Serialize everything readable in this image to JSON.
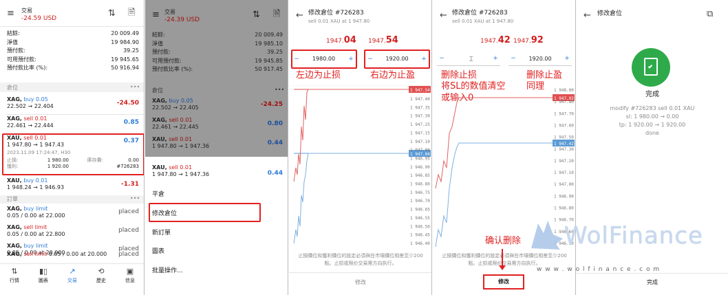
{
  "panel1": {
    "title": "交易",
    "balance_change": "-24.59 USD",
    "summary": [
      {
        "label": "結餘:",
        "value": "20 009.49"
      },
      {
        "label": "淨值",
        "value": "19 984.90"
      },
      {
        "label": "預付款:",
        "value": "39.25"
      },
      {
        "label": "可用預付款:",
        "value": "19 945.65"
      },
      {
        "label": "預付款比率 (%):",
        "value": "50 916.94"
      }
    ],
    "positions_header": "倉位",
    "more": "•••",
    "positions": [
      {
        "sym": "XAG,",
        "side": "buy 0.05",
        "prices": "22.502 → 22.404",
        "profit": "-24.50"
      },
      {
        "sym": "XAG,",
        "side": "sell 0.01",
        "prices": "22.461 → 22.444",
        "profit": "0.85"
      },
      {
        "sym": "XAU,",
        "side": "sell 0.01",
        "prices": "1 947.80 → 1 947.43",
        "profit": "0.37"
      },
      {
        "sym": "XAU,",
        "side": "buy 0.01",
        "prices": "1 948.24 → 1 946.93",
        "profit": "-1.31"
      }
    ],
    "detail_time": "2023.11.09 17:24:47, H30",
    "detail_sl_label": "止損:",
    "detail_sl": "1 980.00",
    "detail_swap_label": "庫存費:",
    "detail_swap": "0.00",
    "detail_tp_label": "獲利:",
    "detail_tp": "1 920.00",
    "detail_ticket": "#726283",
    "orders_header": "訂單",
    "orders": [
      {
        "sym": "XAG,",
        "side": "buy limit",
        "desc": "0.05 / 0.00 at 22.000",
        "status": "placed"
      },
      {
        "sym": "XAG,",
        "side": "sell limit",
        "desc": "0.05 / 0.00 at 22.800",
        "status": "placed"
      },
      {
        "sym": "XAG,",
        "side": "buy limit",
        "desc": "0.05 / 0.00 at 20.000",
        "status": "placed"
      },
      {
        "sym": "XAG,",
        "side": "sell limit",
        "desc": "0.05 / 0.00 at 20.000",
        "status": "placed"
      }
    ],
    "nav": [
      "行情",
      "圖表",
      "交易",
      "歷史",
      "信息"
    ]
  },
  "panel2": {
    "title": "交易",
    "balance_change": "-24.39 USD",
    "summary": [
      {
        "label": "結餘:",
        "value": "20 009.49"
      },
      {
        "label": "淨值",
        "value": "19 985.10"
      },
      {
        "label": "預付款:",
        "value": "39.25"
      },
      {
        "label": "可用預付款:",
        "value": "19 945.85"
      },
      {
        "label": "預付款比率 (%):",
        "value": "50 917.45"
      }
    ],
    "positions_header": "倉位",
    "more": "•••",
    "positions": [
      {
        "sym": "XAG,",
        "side": "buy 0.05",
        "prices": "22.502 → 22.405",
        "profit": "-24.25"
      },
      {
        "sym": "XAG,",
        "side": "sell 0.01",
        "prices": "22.461 → 22.445",
        "profit": "0.80"
      },
      {
        "sym": "XAU,",
        "side": "sell 0.01",
        "prices": "1 947.80 → 1 947.36",
        "profit": "0.44"
      },
      {
        "sym": "XAU,",
        "side": "sell 0.01",
        "prices": "1 947.80 → 1 947.36",
        "profit": "0.44"
      }
    ],
    "detail_time": "2023.11.09 17:24:47, H30",
    "menu": [
      "平倉",
      "修改倉位",
      "新訂單",
      "圖表",
      "批量操作..."
    ]
  },
  "panel3": {
    "title": "修改倉位 #726283",
    "subtitle": "sell 0.01 XAU at 1 947.80",
    "bid_main": "1947.",
    "bid_big": "04",
    "ask_main": "1947.",
    "ask_big": "54",
    "sl_value": "1980.00",
    "tp_value": "1920.00",
    "minus": "−",
    "plus": "+",
    "ann_left": "左边为止损",
    "ann_right": "右边为止盈",
    "price_labels": [
      "1 947.40",
      "1 947.35",
      "1 947.30",
      "1 947.25",
      "1 947.15",
      "1 947.10",
      "1 947.00",
      "1 946.95",
      "1 946.90",
      "1 946.85",
      "1 946.80",
      "1 946.75",
      "1 946.70",
      "1 946.65",
      "1 946.55",
      "1 946.50",
      "1 946.45",
      "1 946.40"
    ],
    "price_tag_red": "1 947.54",
    "price_tag_blue": "1 947.04",
    "note": "止損價位和獲利價位的設定必須與在市場價位相差至少200點。止损或限价交易需方向执行。",
    "button": "修改"
  },
  "panel4": {
    "title": "修改倉位 #726283",
    "subtitle": "sell 0.01 XAU at 1 947.80",
    "bid_main": "1947.",
    "bid_big": "42",
    "ask_main": "1947.",
    "ask_big": "92",
    "sl_value": "",
    "tp_value": "1920.00",
    "minus": "−",
    "plus": "+",
    "ann_sl": "删除止损\n将SL的数值清空\n或输入0",
    "ann_tp": "删除止盈\n同理",
    "ann_confirm": "确认删除",
    "price_labels": [
      "1 948.00",
      "1 947.80",
      "1 947.70",
      "1 947.60",
      "1 947.50",
      "1 947.30",
      "1 947.20",
      "1 947.10",
      "1 947.00",
      "1 946.90",
      "1 946.80",
      "1 946.70",
      "1 946.60",
      "1 946.50"
    ],
    "price_tag_red": "1 947.92",
    "price_tag_blue": "1 947.42",
    "note": "止損價位和獲利價位的設定必須與在市場價位相差至少200點。止损或限价交易需方向执行。",
    "button": "修改"
  },
  "panel5": {
    "title": "修改倉位",
    "done_title": "完成",
    "lines": [
      "modify #726283 sell 0.01 XAU",
      "sl: 1 980.00 → 0.00",
      "tp: 1 920.00 → 1 920.00",
      "done"
    ],
    "button": "完成"
  },
  "watermark": {
    "brand": "WolFinance",
    "url": "w w w . w o l f i n a n c e . c o m"
  },
  "colors": {
    "accent_blue": "#2e7bd7",
    "loss_red": "#d21f1f",
    "annotation_red": "#e02020",
    "success_green": "#2eaa4a",
    "dim_overlay": "#9a9a9a"
  }
}
